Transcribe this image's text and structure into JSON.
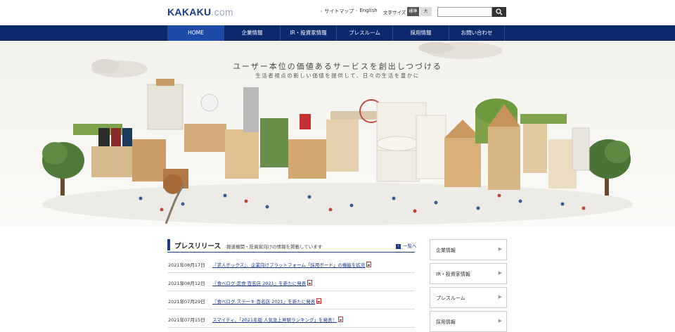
{
  "header": {
    "logo_main": "KAKAKU",
    "logo_suffix": ".com",
    "sitemap": "サイトマップ",
    "english": "English",
    "font_size_label": "文字サイズ",
    "font_std": "標準",
    "font_large": "大",
    "search_placeholder": ""
  },
  "nav": {
    "items": [
      {
        "label": "HOME"
      },
      {
        "label": "企業情報"
      },
      {
        "label": "IR・投資家情報"
      },
      {
        "label": "プレスルーム"
      },
      {
        "label": "採用情報"
      },
      {
        "label": "お問い合わせ"
      }
    ]
  },
  "hero": {
    "title": "ユーザー本位の価値あるサービスを創出しつづける",
    "subtitle": "生活者視点の新しい価値を提供して、日々の生活を豊かに"
  },
  "press": {
    "heading": "プレスリリース",
    "description": "報道機関・投資家向けの情報を掲載しています",
    "list_link": "一覧へ",
    "items": [
      {
        "date": "2021年08月17日",
        "title": "『求人ボックス』、企業向けプラットフォーム「採用ボード」の機能を拡充"
      },
      {
        "date": "2021年08月12日",
        "title": "『食べログ 定食 百名店 2021』を新たに発表"
      },
      {
        "date": "2021年07月29日",
        "title": "『食べログ ステーキ 百名店 2021』を新たに発表"
      },
      {
        "date": "2021年07月15日",
        "title": "スマイティ、「2021年版 人気急上昇駅ランキング」を発表！"
      }
    ]
  },
  "sidebar": {
    "items": [
      {
        "label": "企業情報"
      },
      {
        "label": "IR・投資家情報"
      },
      {
        "label": "プレスルーム"
      },
      {
        "label": "採用情報"
      }
    ]
  },
  "colors": {
    "brand": "#1b3a8c",
    "nav_bg": "#0a2a6e",
    "nav_active": "#1c4aa6"
  }
}
